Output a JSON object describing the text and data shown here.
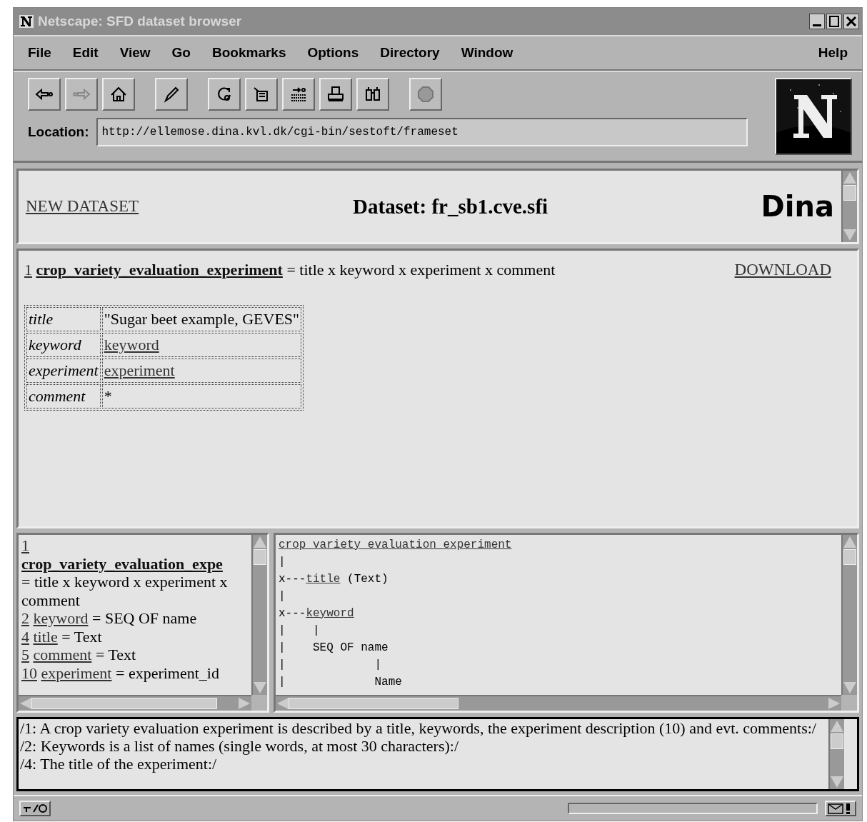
{
  "window": {
    "title": "Netscape: SFD dataset browser"
  },
  "menu": {
    "items": [
      "File",
      "Edit",
      "View",
      "Go",
      "Bookmarks",
      "Options",
      "Directory",
      "Window"
    ],
    "help": "Help"
  },
  "toolbar": [
    {
      "kind": "back",
      "disabled": false
    },
    {
      "kind": "forward",
      "disabled": true
    },
    {
      "kind": "home",
      "disabled": false
    },
    {
      "kind": "edit",
      "disabled": false
    },
    {
      "kind": "reload",
      "disabled": false
    },
    {
      "kind": "images",
      "disabled": false
    },
    {
      "kind": "open",
      "disabled": false
    },
    {
      "kind": "print",
      "disabled": false
    },
    {
      "kind": "find",
      "disabled": false
    },
    {
      "kind": "stop",
      "disabled": true
    }
  ],
  "location": {
    "label": "Location:",
    "value": "http://ellemose.dina.kvl.dk/cgi-bin/sestoft/frameset"
  },
  "top_frame": {
    "link": "NEW DATASET",
    "heading": "Dataset: fr_sb1.cve.sfi",
    "logo": "Dina"
  },
  "main_frame": {
    "number": "1",
    "name": "crop_variety_evaluation_experiment",
    "rhs": "= title x keyword x experiment x comment",
    "download": "DOWNLOAD",
    "table": [
      {
        "field": "title",
        "value": "\"Sugar beet example, GEVES\"",
        "kind": "text"
      },
      {
        "field": "keyword",
        "value": "keyword",
        "kind": "link"
      },
      {
        "field": "experiment",
        "value": "experiment",
        "kind": "link"
      },
      {
        "field": "comment",
        "value": "*",
        "kind": "text"
      }
    ]
  },
  "left_frame": [
    {
      "number": "1",
      "name": "crop_variety_evaluation_expe",
      "rhs": "= title x keyword x experiment x comment",
      "kind": "block"
    },
    {
      "number": "2",
      "name": "keyword",
      "rhs": "= SEQ OF name",
      "kind": "inline"
    },
    {
      "number": "4",
      "name": "title",
      "rhs": "= Text",
      "kind": "inline"
    },
    {
      "number": "5",
      "name": "comment",
      "rhs": "= Text",
      "kind": "inline"
    },
    {
      "number": "10",
      "name": "experiment",
      "rhs": "= experiment_id",
      "kind": "inline"
    }
  ],
  "right_frame": [
    {
      "link": "crop variety evaluation experiment"
    },
    {
      "prefix": "|"
    },
    {
      "prefix": "x---",
      "link": "title",
      "suffix": " (Text)"
    },
    {
      "prefix": "|"
    },
    {
      "prefix": "x---",
      "link": "keyword"
    },
    {
      "prefix": "|    |"
    },
    {
      "prefix": "|    SEQ OF name"
    },
    {
      "prefix": "|             |"
    },
    {
      "prefix": "|             Name"
    }
  ],
  "status_bar": {
    "progress": {
      "level": 0
    }
  },
  "comments": [
    "/1:  A crop variety evaluation experiment is described by a title, keywords, the experiment description (10) and evt. comments:/",
    "/2:  Keywords is a list of names (single words, at most 30 characters):/",
    "/4:  The title of the experiment:/"
  ]
}
